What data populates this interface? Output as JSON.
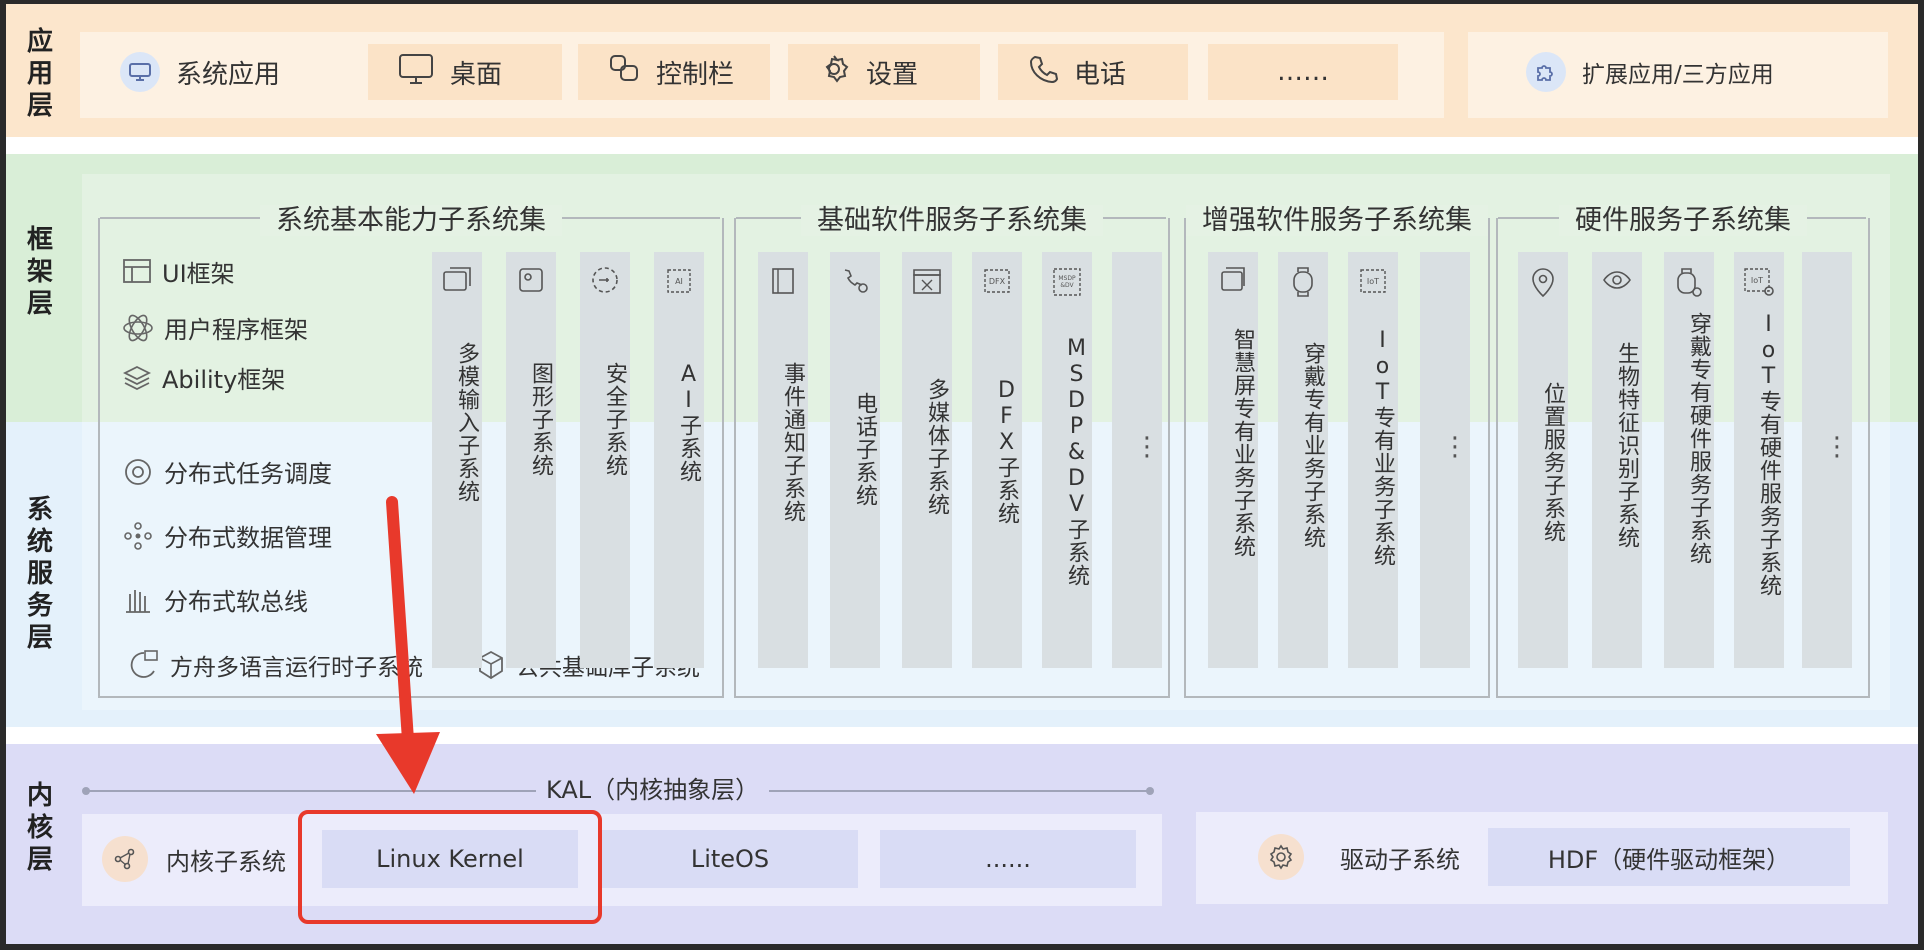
{
  "layers": {
    "app": "应用层",
    "framework": "框架层",
    "system_service": "系统服务层",
    "kernel": "内核层"
  },
  "app_layer": {
    "system_apps_label": "系统应用",
    "items": [
      "桌面",
      "控制栏",
      "设置",
      "电话",
      "……"
    ],
    "extension_label": "扩展应用/三方应用"
  },
  "framework_items": [
    "UI框架",
    "用户程序框架",
    "Ability框架"
  ],
  "distributed_items": [
    "分布式任务调度",
    "分布式数据管理",
    "分布式软总线"
  ],
  "bottom_items": [
    "方舟多语言运行时子系统",
    "公共基础库子系统"
  ],
  "groups": {
    "basic": {
      "title": "系统基本能力子系统集",
      "columns": [
        "多模输入子系统",
        "图形子系统",
        "安全子系统",
        "AI子系统"
      ]
    },
    "software": {
      "title": "基础软件服务子系统集",
      "columns": [
        "事件通知子系统",
        "电话子系统",
        "多媒体子系统",
        "DFX子系统",
        "MSDP&DV子系统",
        "⋮"
      ]
    },
    "enhanced": {
      "title": "增强软件服务子系统集",
      "columns": [
        "智慧屏专有业务子系统",
        "穿戴专有业务子系统",
        "IoT专有业务子系统",
        "⋮"
      ]
    },
    "hardware": {
      "title": "硬件服务子系统集",
      "columns": [
        "位置服务子系统",
        "生物特征识别子系统",
        "穿戴专有硬件服务子系统",
        "IoT专有硬件服务子系统",
        "⋮"
      ]
    }
  },
  "kernel_layer": {
    "kal_label": "KAL（内核抽象层）",
    "kernel_subsystem_label": "内核子系统",
    "kernels": [
      "Linux Kernel",
      "LiteOS",
      "......"
    ],
    "driver_subsystem_label": "驱动子系统",
    "hdf_label": "HDF（硬件驱动框架）"
  },
  "colors": {
    "app_band": "#fce6cc",
    "framework_band": "#d9eed7",
    "system_band": "#e4f1fb",
    "kernel_band": "#dcdcf6",
    "highlight": "#e8392b"
  }
}
